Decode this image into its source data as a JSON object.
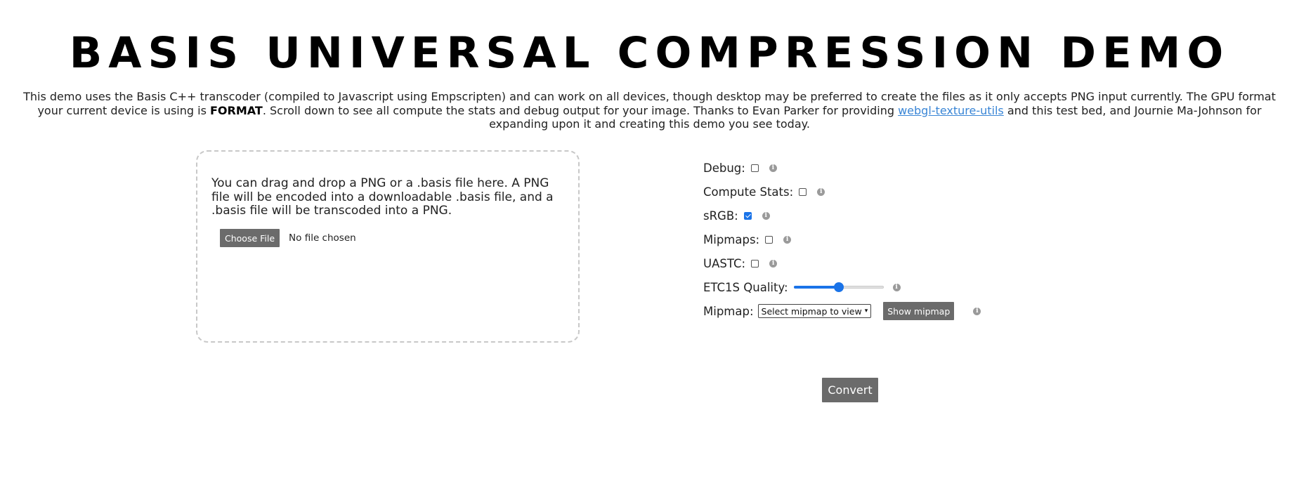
{
  "header": {
    "title": "BASIS UNIVERSAL COMPRESSION DEMO"
  },
  "intro": {
    "text_part1": "This demo uses the Basis C++ transcoder (compiled to Javascript using Empscripten) and can work on all devices, though desktop may be preferred to create the files as it only accepts PNG input currently. The GPU format your current device is using is ",
    "format_label": "FORMAT",
    "text_part2": ". Scroll down to see all compute the stats and debug output for your image. Thanks to Evan Parker for providing ",
    "link_text": "webgl-texture-utils",
    "text_part3": " and this test bed, and Journie Ma-Johnson for expanding upon it and creating this demo you see today."
  },
  "dropzone": {
    "instructions": "You can drag and drop a PNG or a .basis file here. A PNG file will be encoded into a downloadable .basis file, and a .basis file will be transcoded into a PNG.",
    "choose_file_label": "Choose File",
    "file_status": "No file chosen"
  },
  "options": {
    "debug": {
      "label": "Debug:",
      "checked": false
    },
    "compute_stats": {
      "label": "Compute Stats:",
      "checked": false
    },
    "srgb": {
      "label": "sRGB:",
      "checked": true
    },
    "mipmaps": {
      "label": "Mipmaps:",
      "checked": false
    },
    "uastc": {
      "label": "UASTC:",
      "checked": false
    },
    "etc1s_quality": {
      "label": "ETC1S Quality:",
      "fraction": 0.5
    },
    "mipmap": {
      "label": "Mipmap:",
      "select_value": "Select mipmap to view",
      "show_button": "Show mipmap"
    }
  },
  "actions": {
    "convert_label": "Convert"
  },
  "colors": {
    "button_bg": "#6b6b6b",
    "accent": "#1a73e8",
    "link": "#3a86d6"
  },
  "icons": {
    "info": "info-icon",
    "select_chevron": "chevron-down-icon"
  }
}
